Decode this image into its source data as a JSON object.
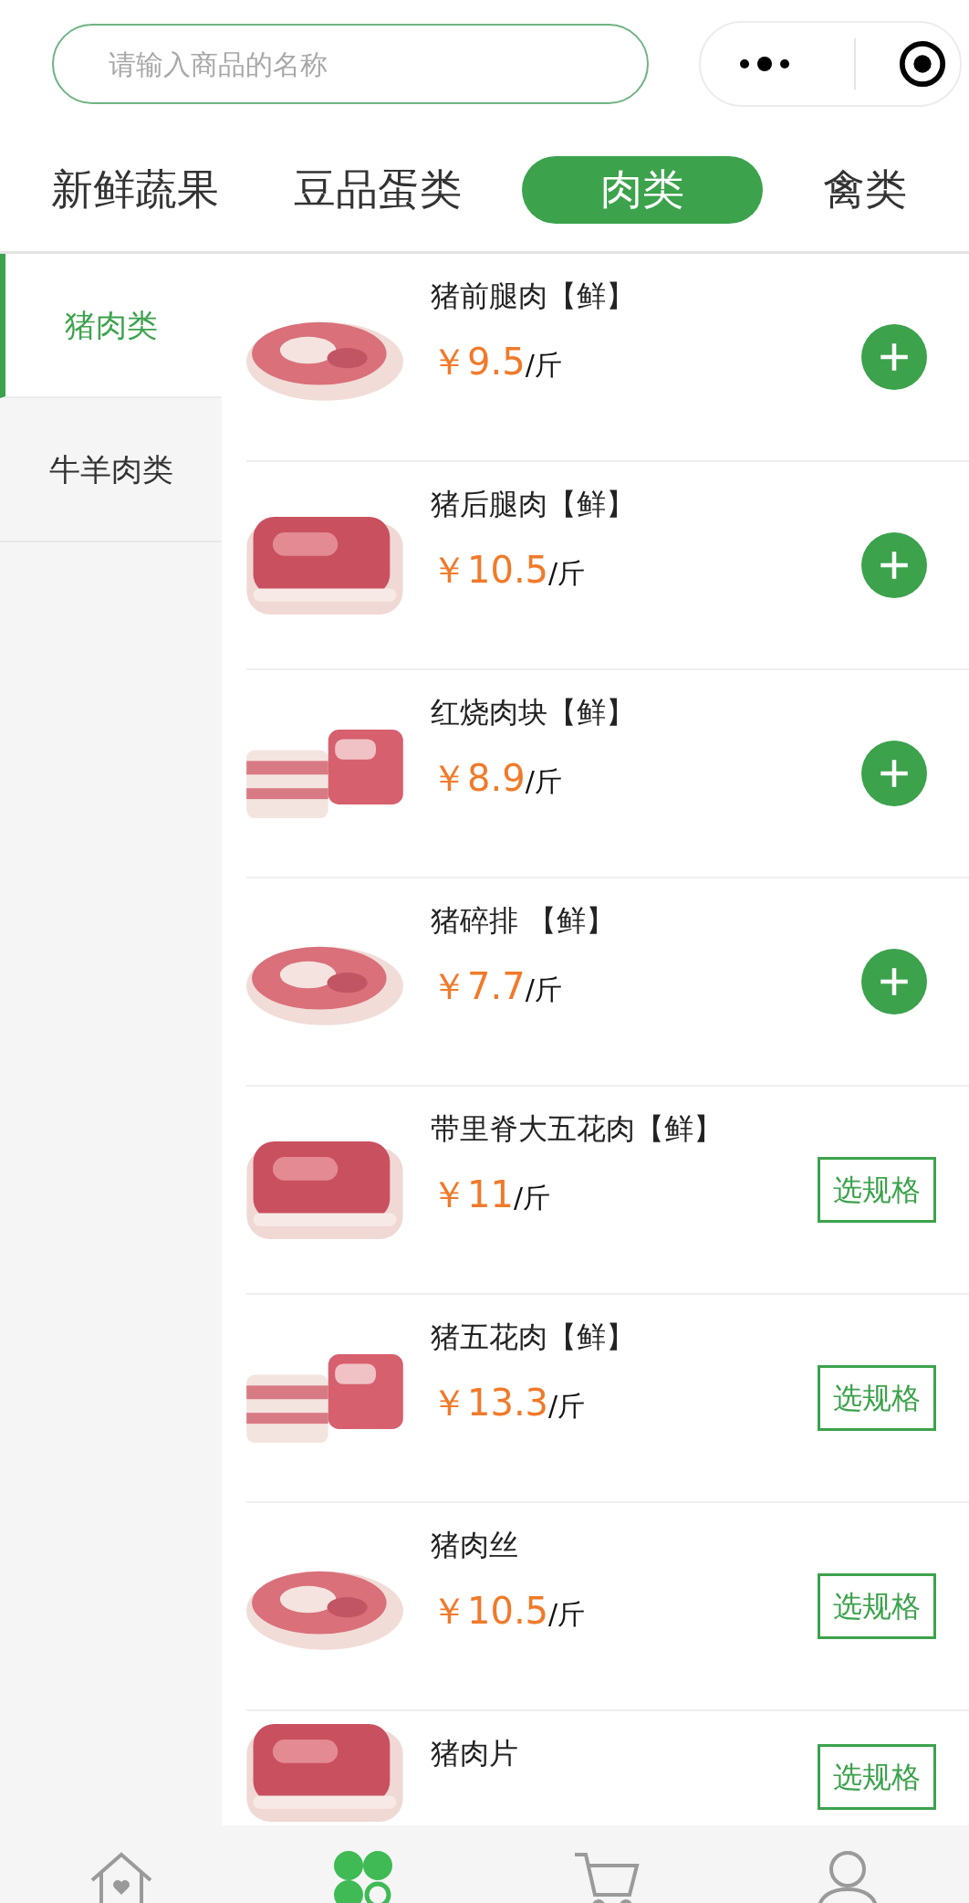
{
  "search": {
    "placeholder": "请输入商品的名称"
  },
  "categories": [
    {
      "label": "新鲜蔬果",
      "selected": false
    },
    {
      "label": "豆品蛋类",
      "selected": false
    },
    {
      "label": "肉类",
      "selected": true
    },
    {
      "label": "禽类",
      "selected": false
    }
  ],
  "sidebar": {
    "items": [
      {
        "label": "猪肉类",
        "selected": true
      },
      {
        "label": "牛羊肉类",
        "selected": false
      }
    ]
  },
  "products": [
    {
      "name": "猪前腿肉【鲜】",
      "currency": "￥",
      "price": "9.5",
      "unit": "/斤",
      "kind": "add"
    },
    {
      "name": "猪后腿肉【鲜】",
      "currency": "￥",
      "price": "10.5",
      "unit": "/斤",
      "kind": "add"
    },
    {
      "name": "红烧肉块【鲜】",
      "currency": "￥",
      "price": "8.9",
      "unit": "/斤",
      "kind": "add"
    },
    {
      "name": "猪碎排 【鲜】",
      "currency": "￥",
      "price": "7.7",
      "unit": "/斤",
      "kind": "add"
    },
    {
      "name": "带里脊大五花肉【鲜】",
      "currency": "￥",
      "price": "11",
      "unit": "/斤",
      "kind": "spec",
      "button": "选规格"
    },
    {
      "name": "猪五花肉【鲜】",
      "currency": "￥",
      "price": "13.3",
      "unit": "/斤",
      "kind": "spec",
      "button": "选规格"
    },
    {
      "name": "猪肉丝",
      "currency": "￥",
      "price": "10.5",
      "unit": "/斤",
      "kind": "spec",
      "button": "选规格"
    },
    {
      "name": "猪肉片",
      "kind": "spec",
      "button": "选规格"
    }
  ],
  "tab_bar": [
    {
      "kind": "home",
      "selected": false
    },
    {
      "kind": "category",
      "selected": true
    },
    {
      "kind": "cart",
      "selected": false
    },
    {
      "kind": "profile",
      "selected": false
    }
  ]
}
